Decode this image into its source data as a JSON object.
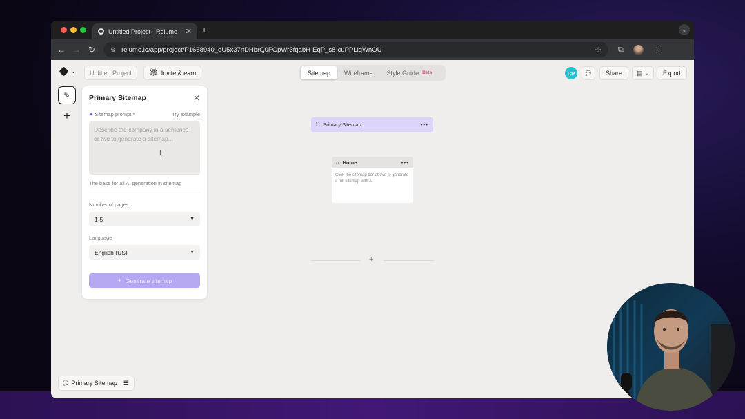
{
  "browser": {
    "tab_title": "Untitled Project - Relume",
    "url": "relume.io/app/project/P1668940_eU5x37nDHbrQ0FGpWr3fqabH-EqP_s8-cuPPLlqWnOU"
  },
  "header": {
    "project_name": "Untitled Project",
    "invite_label": "Invite & earn",
    "view_tabs": [
      {
        "label": "Sitemap",
        "active": true
      },
      {
        "label": "Wireframe",
        "active": false
      },
      {
        "label": "Style Guide",
        "active": false,
        "badge": "Beta"
      }
    ],
    "avatar_initials": "CP",
    "share_label": "Share",
    "export_label": "Export"
  },
  "panel": {
    "title": "Primary Sitemap",
    "prompt_label": "Sitemap prompt *",
    "try_example": "Try example",
    "prompt_placeholder": "Describe the company in a sentence or two to generate a sitemap...",
    "hint": "The base for all AI generation in sitemap",
    "pages_label": "Number of pages",
    "pages_value": "1-5",
    "language_label": "Language",
    "language_value": "English (US)",
    "generate_label": "Generate sitemap"
  },
  "canvas": {
    "sitemap_bar_label": "Primary Sitemap",
    "home_label": "Home",
    "home_body": "Click the sitemap bar above to generate a full sitemap with AI"
  },
  "footer": {
    "sitemap_chip_label": "Primary Sitemap"
  },
  "colors": {
    "accent_purple": "#b5a7f2",
    "sitemap_bar": "#ddd4fa",
    "avatar": "#24c2cf",
    "beta": "#e0578a"
  }
}
